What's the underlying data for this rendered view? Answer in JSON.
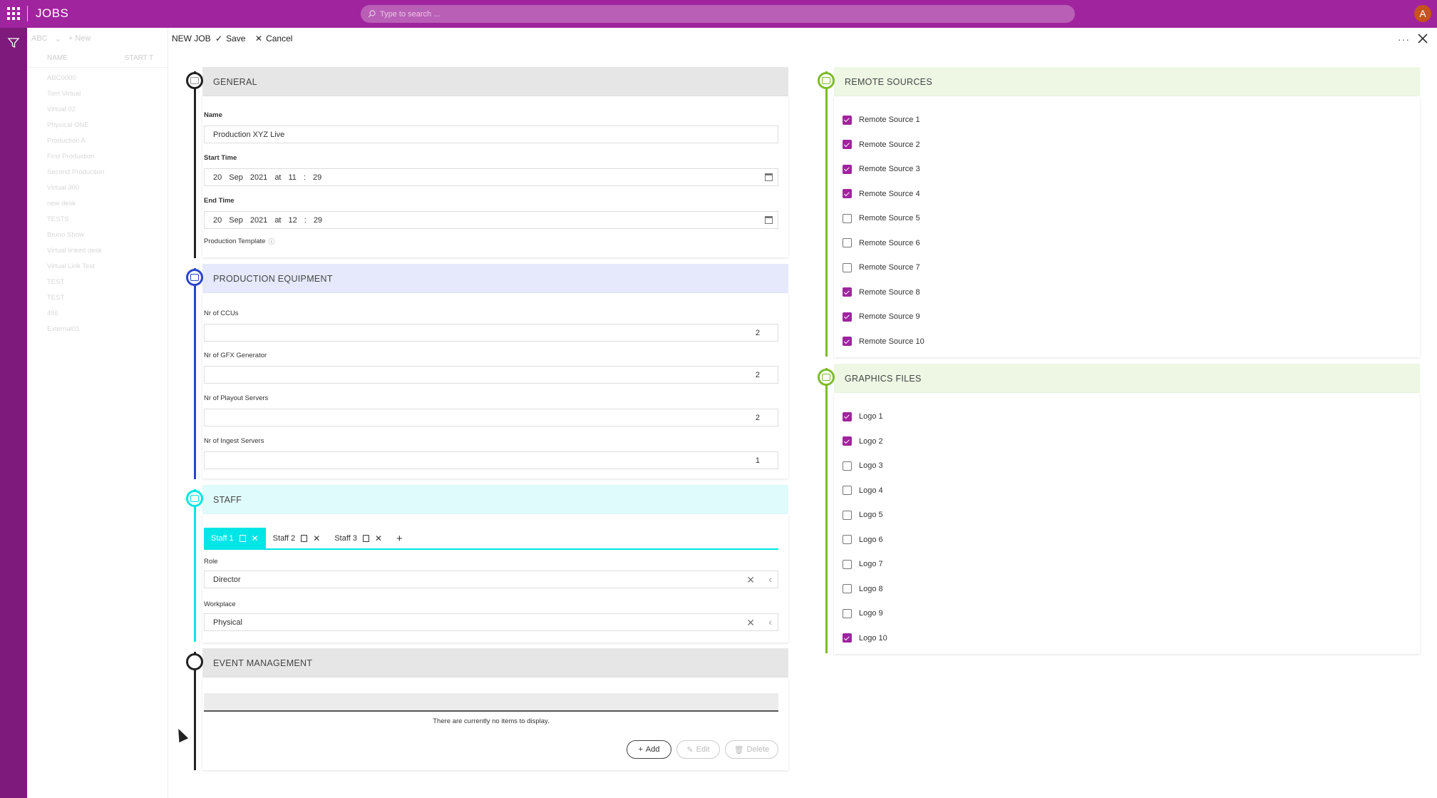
{
  "app": {
    "title": "JOBS",
    "search_placeholder": "Type to search ...",
    "avatar_initial": "A",
    "accent": "#a0249e"
  },
  "list": {
    "toolbar": {
      "view": "ABC",
      "new_label": "New"
    },
    "columns": [
      "NAME",
      "START T"
    ],
    "items": [
      "ABC0000",
      "Tom Virtual",
      "Virtual 02",
      "Physical ONE",
      "Production A",
      "First Production",
      "Second Production",
      "Virtual 300",
      "new desk",
      "TESTS",
      "Bruno Show",
      "Virtual linked desk",
      "Virtual Link Test",
      "TEST",
      "TEST",
      "456",
      "External01"
    ]
  },
  "cmdbar": {
    "title": "NEW JOB",
    "save_label": "Save",
    "cancel_label": "Cancel"
  },
  "general": {
    "title": "GENERAL",
    "name_label": "Name",
    "name_value": "Production XYZ Live",
    "start_label": "Start Time",
    "start": {
      "day": "20",
      "month": "Sep",
      "year": "2021",
      "at": "at",
      "hour": "11",
      "sep": ":",
      "minute": "29"
    },
    "end_label": "End Time",
    "end": {
      "day": "20",
      "month": "Sep",
      "year": "2021",
      "at": "at",
      "hour": "12",
      "sep": ":",
      "minute": "29"
    },
    "template_label": "Production Template"
  },
  "equipment": {
    "title": "PRODUCTION EQUIPMENT",
    "fields": [
      {
        "label": "Nr of CCUs",
        "value": "2"
      },
      {
        "label": "Nr of GFX Generator",
        "value": "2"
      },
      {
        "label": "Nr of Playout Servers",
        "value": "2"
      },
      {
        "label": "Nr of Ingest Servers",
        "value": "1"
      }
    ]
  },
  "staff": {
    "title": "STAFF",
    "tabs": [
      "Staff 1",
      "Staff 2",
      "Staff 3"
    ],
    "role_label": "Role",
    "role_value": "Director",
    "workplace_label": "Workplace",
    "workplace_value": "Physical"
  },
  "events": {
    "title": "EVENT MANAGEMENT",
    "empty_text": "There are currently no items to display.",
    "add_label": "Add",
    "edit_label": "Edit",
    "delete_label": "Delete"
  },
  "remote": {
    "title": "REMOTE SOURCES",
    "items": [
      {
        "label": "Remote Source 1",
        "checked": true
      },
      {
        "label": "Remote Source 2",
        "checked": true
      },
      {
        "label": "Remote Source 3",
        "checked": true
      },
      {
        "label": "Remote Source 4",
        "checked": true
      },
      {
        "label": "Remote Source 5",
        "checked": false
      },
      {
        "label": "Remote Source 6",
        "checked": false
      },
      {
        "label": "Remote Source 7",
        "checked": false
      },
      {
        "label": "Remote Source 8",
        "checked": true
      },
      {
        "label": "Remote Source 9",
        "checked": true
      },
      {
        "label": "Remote Source 10",
        "checked": true
      }
    ]
  },
  "graphics": {
    "title": "GRAPHICS FILES",
    "items": [
      {
        "label": "Logo 1",
        "checked": true
      },
      {
        "label": "Logo 2",
        "checked": true
      },
      {
        "label": "Logo 3",
        "checked": false
      },
      {
        "label": "Logo 4",
        "checked": false
      },
      {
        "label": "Logo 5",
        "checked": false
      },
      {
        "label": "Logo 6",
        "checked": false
      },
      {
        "label": "Logo 7",
        "checked": false
      },
      {
        "label": "Logo 8",
        "checked": false
      },
      {
        "label": "Logo 9",
        "checked": false
      },
      {
        "label": "Logo 10",
        "checked": true
      }
    ]
  }
}
